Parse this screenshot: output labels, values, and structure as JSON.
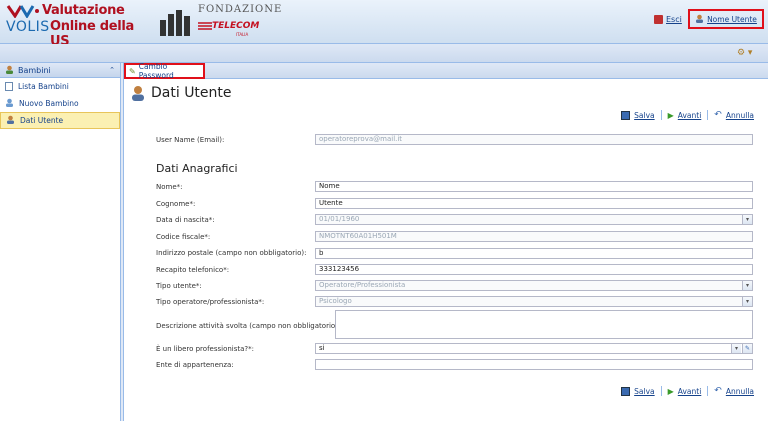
{
  "header": {
    "logo_line1": "Valutazione",
    "logo_volis": "VOLIS",
    "logo_line2": "Online della US",
    "fondazione": "FONDAZIONE",
    "telecom": "TELECOM",
    "telecom_sub": "ITALIA",
    "esci_label": "Esci",
    "user_label": "Nome Utente"
  },
  "sidebar": {
    "header": "Bambini",
    "items": [
      {
        "label": "Lista Bambini",
        "icon": "list-icon"
      },
      {
        "label": "Nuovo Bambino",
        "icon": "new-child-icon"
      },
      {
        "label": "Dati Utente",
        "icon": "user-icon",
        "selected": true
      }
    ]
  },
  "main": {
    "tab_label": "Cambio Password",
    "page_title": "Dati Utente",
    "actions": {
      "save": "Salva",
      "next": "Avanti",
      "cancel": "Annulla"
    },
    "username": {
      "label": "User Name (Email):",
      "value": "operatoreprova@mail.it"
    },
    "section_title": "Dati Anagrafici",
    "fields": [
      {
        "label": "Nome*:",
        "value": "Nome",
        "disabled": false
      },
      {
        "label": "Cognome*:",
        "value": "Utente",
        "disabled": false
      },
      {
        "label": "Data di nascita*:",
        "value": "01/01/1960",
        "disabled": true,
        "trigger": "▾"
      },
      {
        "label": "Codice fiscale*:",
        "value": "NMOTNT60A01H501M",
        "disabled": true
      },
      {
        "label": "Indirizzo postale (campo non obbligatorio):",
        "value": "b",
        "disabled": false
      },
      {
        "label": "Recapito telefonico*:",
        "value": "333123456",
        "disabled": false
      },
      {
        "label": "Tipo utente*:",
        "value": "Operatore/Professionista",
        "disabled": true,
        "trigger": "▾"
      },
      {
        "label": "Tipo operatore/professionista*:",
        "value": "Psicologo",
        "disabled": true,
        "trigger": "▾"
      },
      {
        "label": "Descrizione attività svolta (campo non obbligatorio):",
        "value": "",
        "disabled": false,
        "textarea": true
      },
      {
        "label": "È un libero professionista?*:",
        "value": "si",
        "disabled": false,
        "trigger": "▾"
      },
      {
        "label": "Ente di appartenenza:",
        "value": "",
        "disabled": false
      }
    ]
  },
  "colors": {
    "accent": "#15428b",
    "highlight": "#e0101a",
    "selected_bg": "#fbf0b2"
  }
}
